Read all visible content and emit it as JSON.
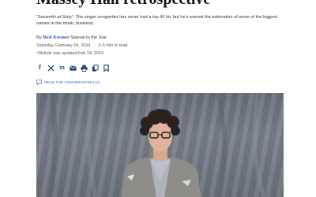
{
  "article": {
    "headline": "Massey Hall retrospective",
    "deck": "“Sexsmith at Sixty”: The singer-songwriter has never had a top 40 hit, but he’s earned the admiration of some of the biggest names in the music business.",
    "byline_prefix": "By",
    "author": "Nick Krewen",
    "byline_suffix": "Special to the Star",
    "date": "Saturday, February 24, 2024",
    "read_time": "5 min to read",
    "updated": "Article was updated Feb 24, 2024"
  },
  "share": {
    "icons": [
      "facebook-icon",
      "x-icon",
      "linkedin-icon",
      "email-icon",
      "print-icon",
      "copy-icon",
      "bookmark-icon"
    ]
  },
  "conversation": {
    "label": "READ THE CONVERSATION (1)"
  },
  "colors": {
    "accent": "#2a5db0",
    "icon": "#1f3f7a"
  }
}
